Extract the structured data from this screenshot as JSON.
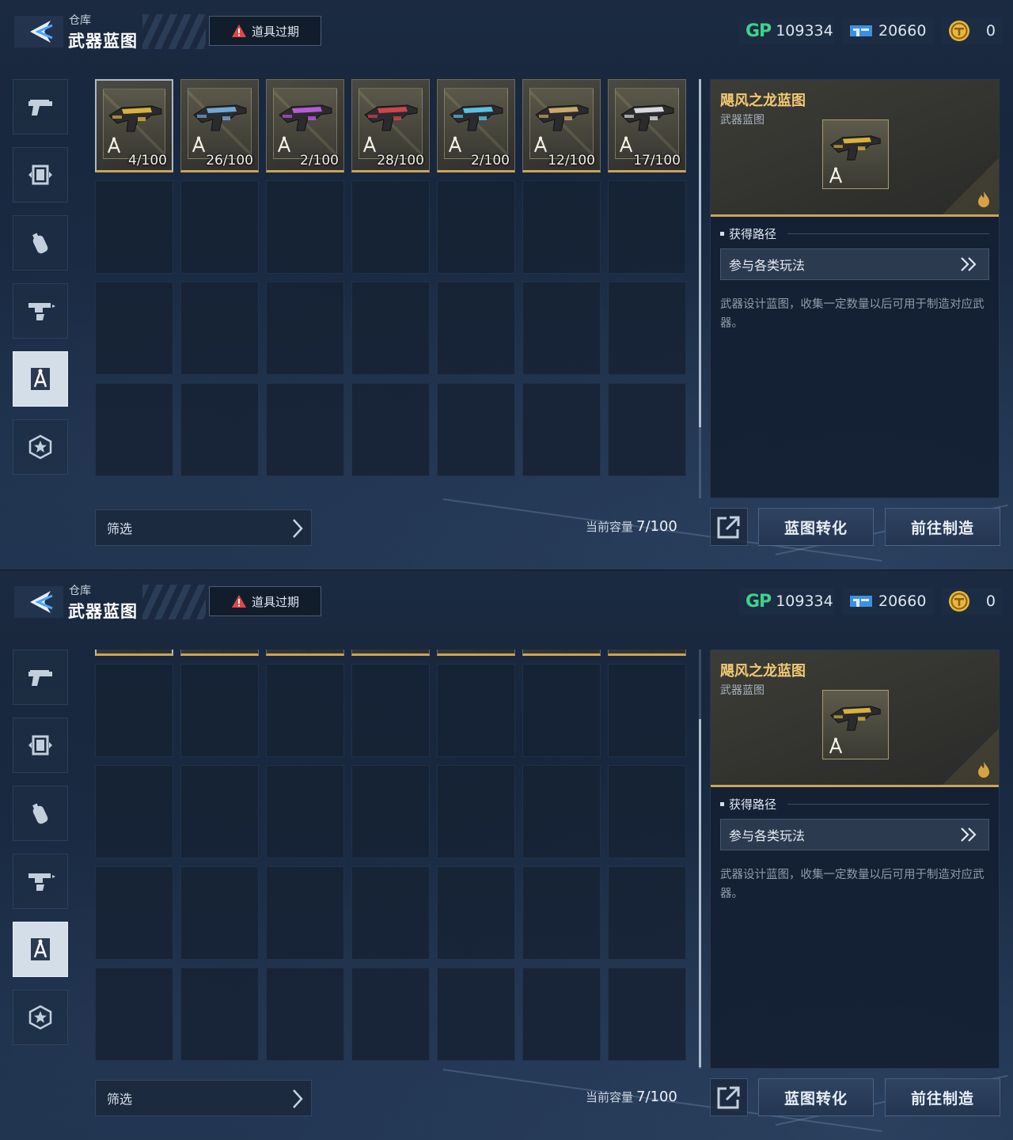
{
  "header": {
    "subtitle": "仓库",
    "title": "武器蓝图",
    "expire_label": "道具过期"
  },
  "currency": {
    "gp_logo": "GP",
    "gp": "109334",
    "tickets": "20660",
    "coins": "0"
  },
  "sidebar": {
    "tabs": [
      {
        "icon": "pistol-icon",
        "active": false
      },
      {
        "icon": "frame-icon",
        "active": false
      },
      {
        "icon": "grenade-icon",
        "active": false
      },
      {
        "icon": "weapon-parts-icon",
        "active": false
      },
      {
        "icon": "blueprint-compass-icon",
        "active": true
      },
      {
        "icon": "star-badge-icon",
        "active": false
      }
    ]
  },
  "inventory": {
    "items": [
      {
        "count": "4/100",
        "tint": "#d8b23a",
        "selected": true
      },
      {
        "count": "26/100",
        "tint": "#6fa8d8",
        "selected": false
      },
      {
        "count": "2/100",
        "tint": "#b85ad8",
        "selected": false
      },
      {
        "count": "28/100",
        "tint": "#d0444e",
        "selected": false
      },
      {
        "count": "2/100",
        "tint": "#5ac0e8",
        "selected": false
      },
      {
        "count": "12/100",
        "tint": "#c9a86a",
        "selected": false
      },
      {
        "count": "17/100",
        "tint": "#d8d8e0",
        "selected": false
      }
    ],
    "filter_label": "筛选",
    "capacity_label": "当前容量",
    "capacity_value": "7/100"
  },
  "detail": {
    "name": "飓风之龙蓝图",
    "type": "武器蓝图",
    "source_title": "获得路径",
    "source_button": "参与各类玩法",
    "description": "武器设计蓝图，收集一定数量以后可用于制造对应武器。"
  },
  "actions": {
    "convert": "蓝图转化",
    "craft": "前往制造"
  },
  "colors": {
    "accent_gold": "#c9a55a",
    "title_gold": "#f1c873",
    "gp_green": "#3fd28c"
  }
}
